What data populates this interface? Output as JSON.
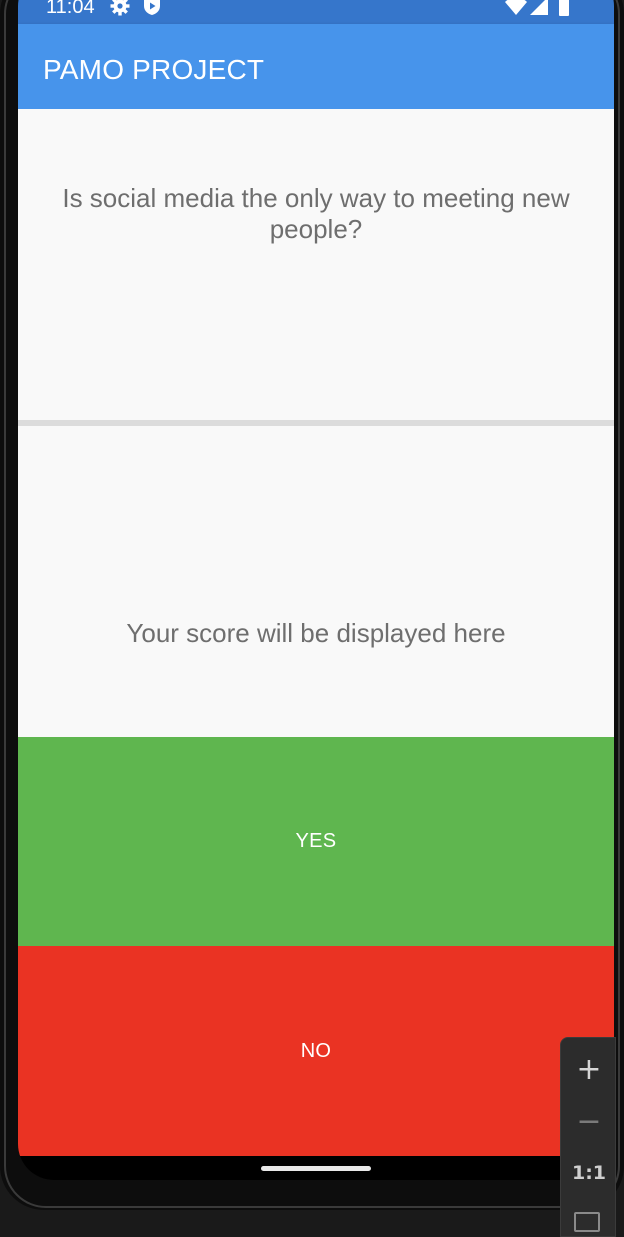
{
  "status_bar": {
    "time": "11:04",
    "icons": [
      "gear-icon",
      "shield-play-icon",
      "wifi-icon",
      "signal-icon",
      "battery-icon"
    ]
  },
  "app_bar": {
    "title": "PAMO PROJECT"
  },
  "question": {
    "text": "Is social media the only way to meeting new people?"
  },
  "score": {
    "text": "Your score will be displayed here"
  },
  "buttons": {
    "yes_label": "YES",
    "no_label": "NO"
  },
  "zoom_controls": {
    "zoom_in": "+",
    "zoom_out": "−",
    "reset": "1:1"
  },
  "colors": {
    "status_bar": "#3676cb",
    "app_bar": "#4794eb",
    "yes": "#5fb64f",
    "no": "#ea3323",
    "text_gray": "#6e6e6e",
    "background": "#f9f9f9"
  }
}
